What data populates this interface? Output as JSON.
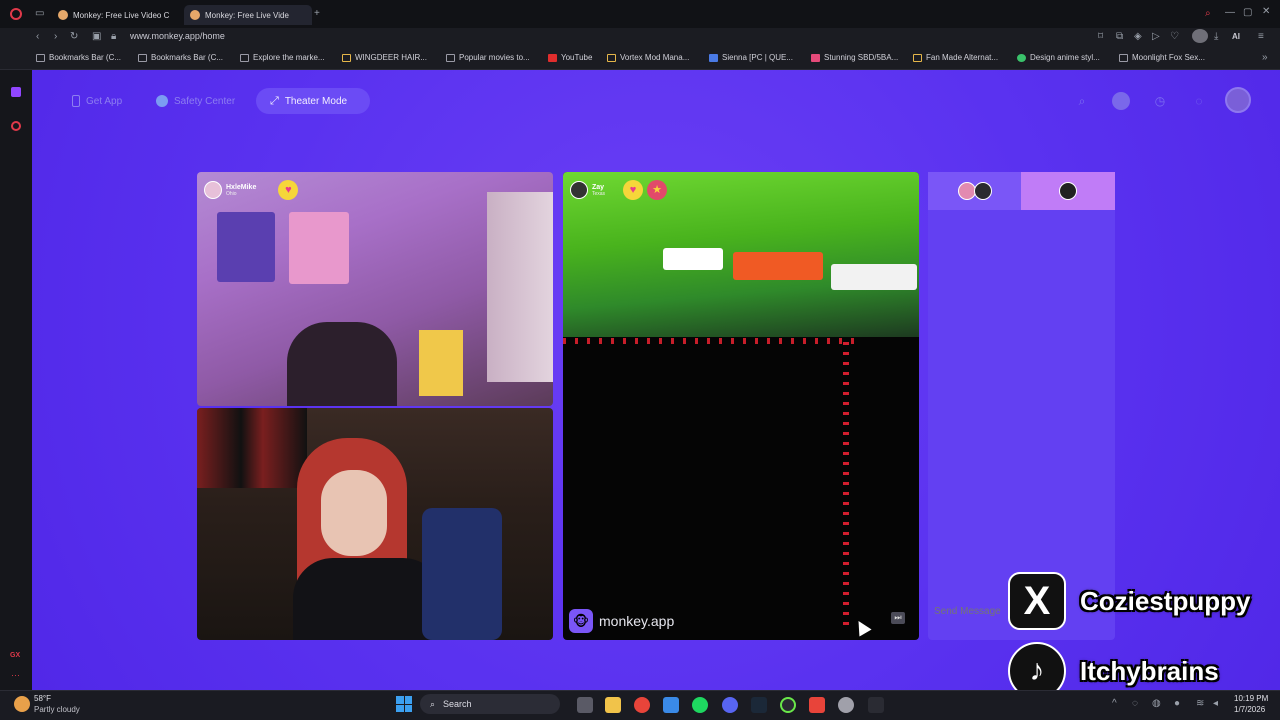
{
  "browser": {
    "tabs": [
      {
        "title": "Monkey: Free Live Video C"
      },
      {
        "title": "Monkey: Free Live Vide"
      }
    ],
    "url": "www.monkey.app/home",
    "ai_label": "AI",
    "bookmarks": [
      {
        "label": "Bookmarks Bar (C..."
      },
      {
        "label": "Bookmarks Bar (C..."
      },
      {
        "label": "Explore the marke..."
      },
      {
        "label": "WINGDEER HAIR..."
      },
      {
        "label": "Popular movies to..."
      },
      {
        "label": "YouTube"
      },
      {
        "label": "Vortex Mod Mana..."
      },
      {
        "label": "Sienna [PC | QUE..."
      },
      {
        "label": "Stunning SBD/5BA..."
      },
      {
        "label": "Fan Made Alternat..."
      },
      {
        "label": "Design anime styl..."
      },
      {
        "label": "Moonlight Fox Sex..."
      }
    ]
  },
  "nav": {
    "get_app": "Get App",
    "safety_center": "Safety Center",
    "theater_mode": "Theater Mode"
  },
  "videos": {
    "v1_user": {
      "name": "HxleMike",
      "location": "Ohio"
    },
    "v3_user": {
      "name": "Zay",
      "location": "Texas"
    },
    "watermark": "monkey.app"
  },
  "chat": {
    "placeholder": "Send Message"
  },
  "overlays": {
    "x_handle": "Coziestpuppy",
    "tiktok_handle": "Itchybrains"
  },
  "taskbar": {
    "weather_temp": "58°F",
    "weather_desc": "Partly cloudy",
    "search_label": "Search",
    "time": "10:19 PM",
    "date": "1/7/2026"
  },
  "colors": {
    "page_bg": "#5a32f0",
    "accent": "#6b4bf5",
    "chat_bg": "#6340f2"
  }
}
